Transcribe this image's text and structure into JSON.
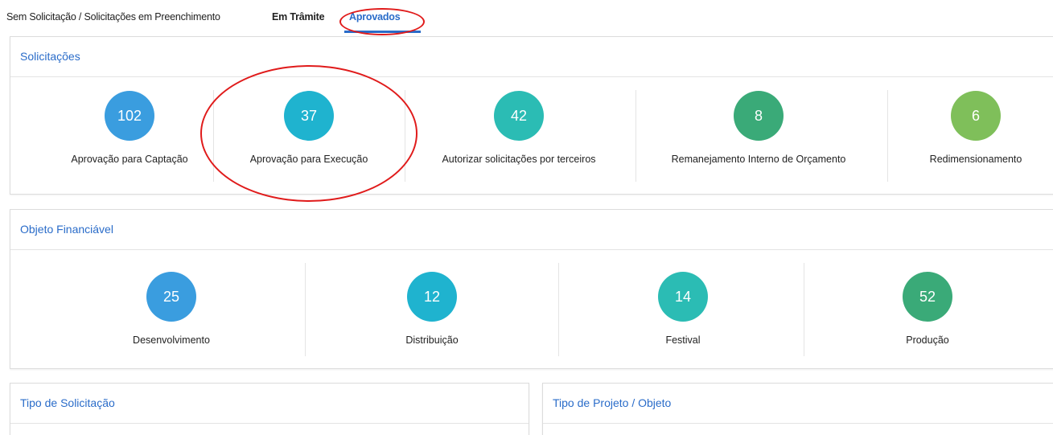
{
  "tabs": [
    {
      "label": "Sem Solicitação / Solicitações em Preenchimento"
    },
    {
      "label": "Em Trâmite"
    },
    {
      "label": "Aprovados"
    }
  ],
  "solicitacoes": {
    "title": "Solicitações",
    "items": [
      {
        "value": "102",
        "label": "Aprovação para Captação",
        "color": "#3a9ddf"
      },
      {
        "value": "37",
        "label": "Aprovação para Execução",
        "color": "#1fb3cf"
      },
      {
        "value": "42",
        "label": "Autorizar solicitações por terceiros",
        "color": "#2bbcb4"
      },
      {
        "value": "8",
        "label": "Remanejamento Interno de Orçamento",
        "color": "#3aaa78"
      },
      {
        "value": "6",
        "label": "Redimensionamento",
        "color": "#7fbf5a"
      }
    ]
  },
  "objeto": {
    "title": "Objeto Financiável",
    "items": [
      {
        "value": "25",
        "label": "Desenvolvimento",
        "color": "#3a9ddf"
      },
      {
        "value": "12",
        "label": "Distribuição",
        "color": "#1fb3cf"
      },
      {
        "value": "14",
        "label": "Festival",
        "color": "#2bbcb4"
      },
      {
        "value": "52",
        "label": "Produção",
        "color": "#3aaa78"
      }
    ]
  },
  "tipo_solicitacao": {
    "title": "Tipo de Solicitação"
  },
  "tipo_projeto": {
    "title": "Tipo de Projeto / Objeto"
  }
}
